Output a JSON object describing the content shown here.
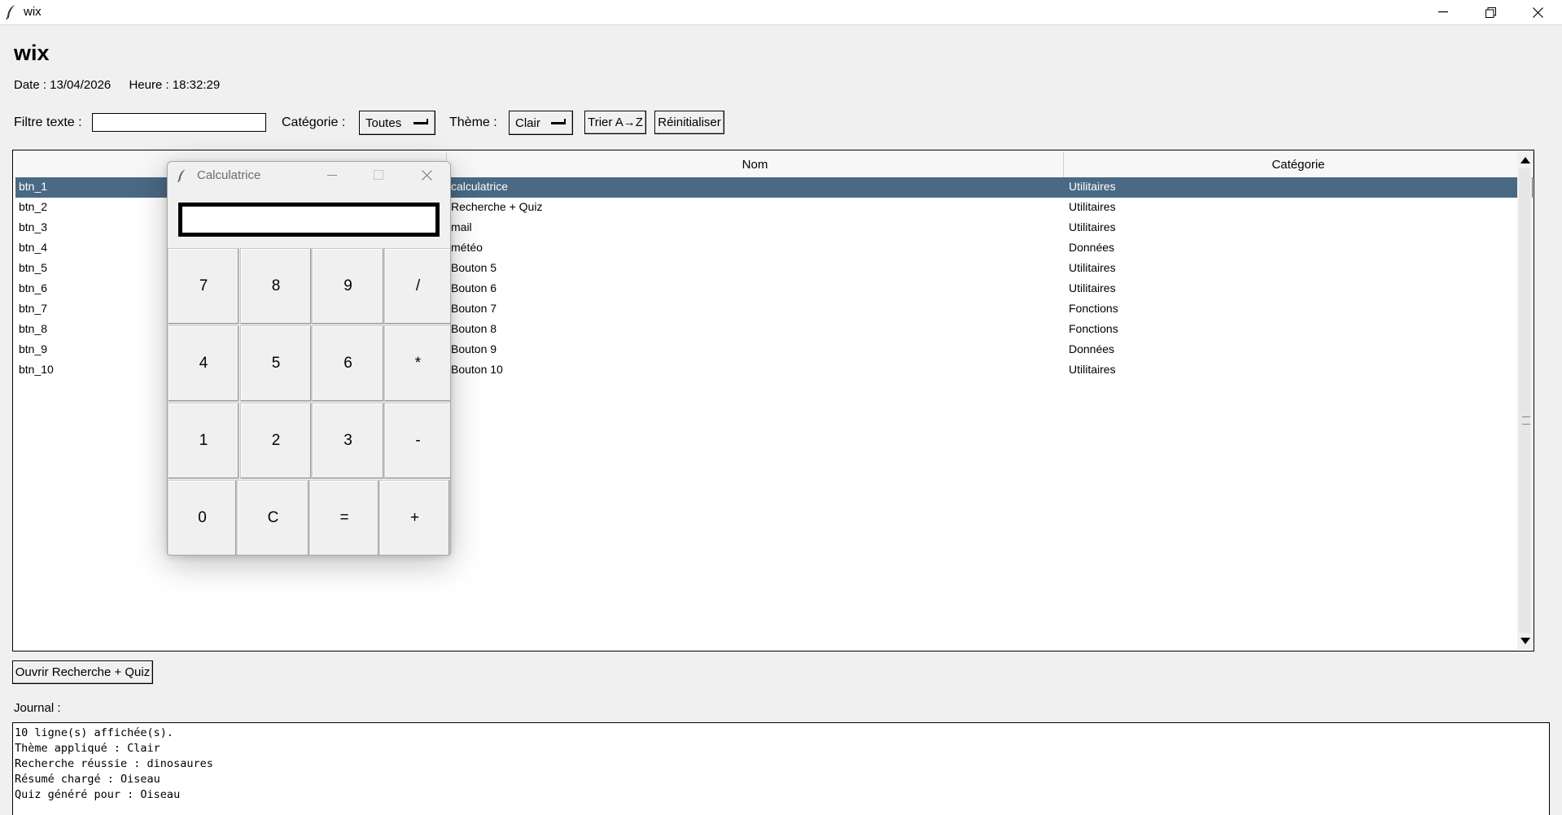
{
  "window": {
    "title": "wix"
  },
  "app": {
    "heading": "wix",
    "date": "Date : 13/04/2026",
    "time": "Heure : 18:32:29"
  },
  "filters": {
    "text_label": "Filtre texte :",
    "text_value": "",
    "category_label": "Catégorie :",
    "category_value": "Toutes",
    "theme_label": "Thème :",
    "theme_value": "Clair",
    "sort_label": "Trier A→Z",
    "reset_label": "Réinitialiser"
  },
  "table": {
    "columns": [
      "",
      "Nom",
      "Catégorie"
    ],
    "rows": [
      {
        "id": "btn_1",
        "nom": "calculatrice",
        "categorie": "Utilitaires",
        "selected": true
      },
      {
        "id": "btn_2",
        "nom": "Recherche + Quiz",
        "categorie": "Utilitaires"
      },
      {
        "id": "btn_3",
        "nom": "mail",
        "categorie": "Utilitaires"
      },
      {
        "id": "btn_4",
        "nom": "météo",
        "categorie": "Données"
      },
      {
        "id": "btn_5",
        "nom": "Bouton 5",
        "categorie": "Utilitaires"
      },
      {
        "id": "btn_6",
        "nom": "Bouton 6",
        "categorie": "Utilitaires"
      },
      {
        "id": "btn_7",
        "nom": "Bouton 7",
        "categorie": "Fonctions"
      },
      {
        "id": "btn_8",
        "nom": "Bouton 8",
        "categorie": "Fonctions"
      },
      {
        "id": "btn_9",
        "nom": "Bouton 9",
        "categorie": "Données"
      },
      {
        "id": "btn_10",
        "nom": "Bouton 10",
        "categorie": "Utilitaires"
      }
    ]
  },
  "open_button_label": "Ouvrir Recherche + Quiz",
  "journal": {
    "label": "Journal :",
    "lines": [
      "10 ligne(s) affichée(s).",
      "Thème appliqué : Clair",
      "Recherche réussie : dinosaures",
      "Résumé chargé : Oiseau",
      "Quiz généré pour : Oiseau"
    ]
  },
  "calculator": {
    "title": "Calculatrice",
    "display_value": "",
    "keys": [
      [
        "7",
        "8",
        "9",
        "/"
      ],
      [
        "4",
        "5",
        "6",
        "*"
      ],
      [
        "1",
        "2",
        "3",
        "-"
      ],
      [
        "0",
        "C",
        "=",
        "+"
      ]
    ]
  },
  "colors": {
    "selection": "#4a6984",
    "background": "#f0f0f0"
  }
}
